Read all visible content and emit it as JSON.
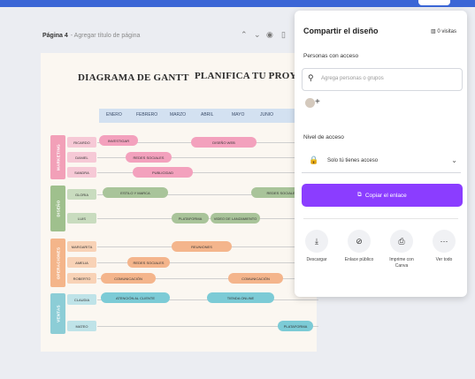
{
  "editor": {
    "page_label": "Página 4",
    "page_sub": "- Agregar título de página",
    "icons": [
      "chevron-up-icon",
      "chevron-down-icon",
      "eye-icon",
      "trash-icon"
    ]
  },
  "gantt": {
    "title_left": "DIAGRAMA DE GANTT",
    "title_right": "PLANIFICA TU PROYECTO",
    "months": [
      "ENERO",
      "FEBRERO",
      "MARZO",
      "ABRIL",
      "MAYO",
      "JUNIO"
    ],
    "sections": [
      {
        "name": "MARKETING",
        "color": "#f2a0b8"
      },
      {
        "name": "DISEÑO",
        "color": "#9fc08d"
      },
      {
        "name": "OPERACIONES",
        "color": "#f4b58a"
      },
      {
        "name": "VENTAS",
        "color": "#8ccdd6"
      }
    ],
    "people": [
      "RICARDO",
      "DANIEL",
      "SANDRA",
      "GLORIA",
      "LUIS",
      "MARGARITA",
      "AMELIA",
      "ROBERTO",
      "CLAUDIA",
      "MATEO"
    ],
    "tasks": [
      "INVESTIGAR",
      "DISEÑO WEB",
      "REDES SOCIALES",
      "PUBLICIDAD",
      "ESTILO Y MARCA",
      "REDES SOCIALES",
      "PLATAFORMA",
      "VIDEO DE LANZAMIENTO",
      "REUNIONES",
      "REDES SOCIALES",
      "COMUNICACIÓN",
      "COMUNICACIÓN",
      "ATENCIÓN AL CLIENTE",
      "TIENDA ONLINE",
      "PLATAFORMA"
    ]
  },
  "share_panel": {
    "title": "Compartir el diseño",
    "visits": "0 visitas",
    "people_label": "Personas con acceso",
    "search_placeholder": "Agrega personas o grupos",
    "access_level_label": "Nivel de acceso",
    "access_value": "Solo tú tienes acceso",
    "copy_link": "Copiar el enlace",
    "actions": [
      "Descargar",
      "Enlace público",
      "Imprime con Canva",
      "Ver todo"
    ]
  },
  "colors": {
    "accent": "#8b3dff",
    "topbar": "#3b66d6"
  }
}
